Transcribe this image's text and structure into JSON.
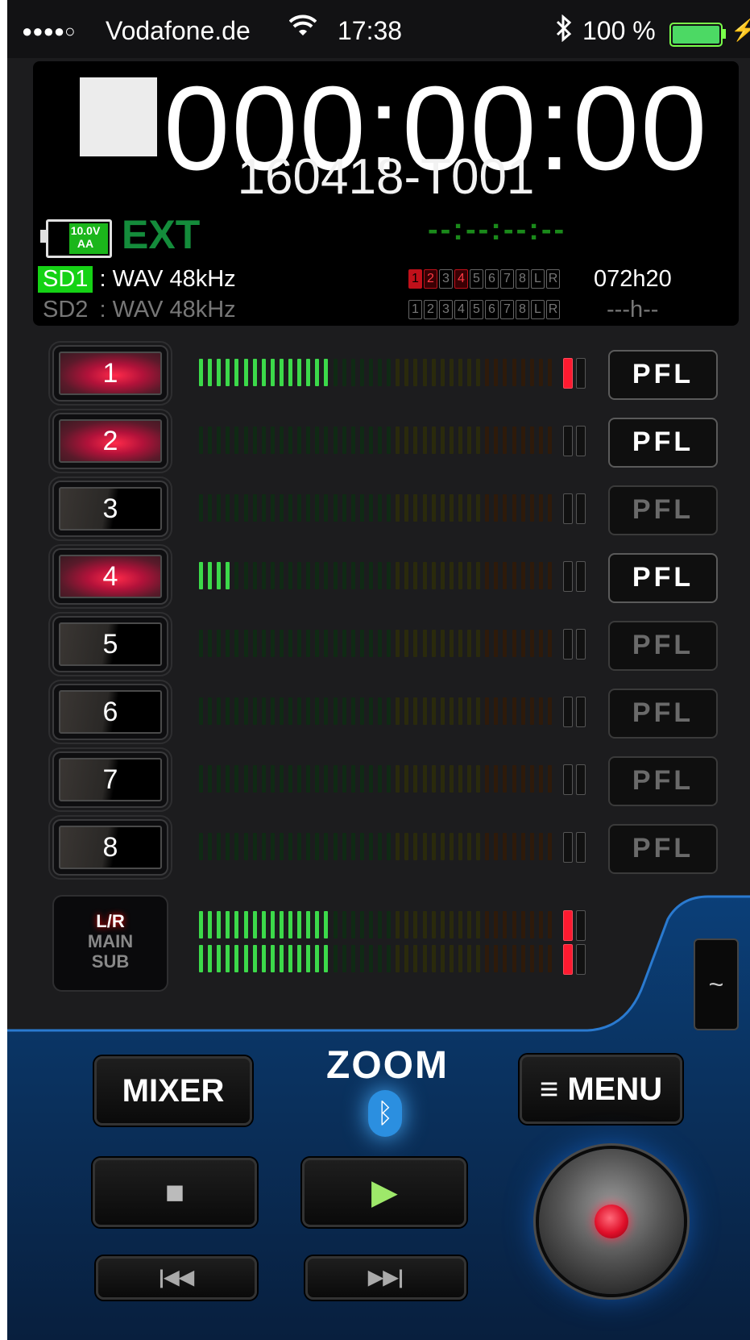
{
  "status_bar": {
    "signal": "●●●●○",
    "carrier": "Vodafone.de",
    "wifi_icon": "wifi-icon",
    "time": "17:38",
    "bluetooth_icon": "bluetooth-icon",
    "battery_percent": "100 %",
    "charging_icon": "⚡"
  },
  "display": {
    "timecode": "000:00:00",
    "take_name": "160418-T001",
    "battery": {
      "voltage": "10.0V",
      "type": "AA",
      "level": 1.0
    },
    "power_source": "EXT",
    "timecode_dashes": "--:--:--:--",
    "sd1": {
      "name": "SD1",
      "format": ": WAV 48kHz",
      "remaining": "072h20",
      "active": true
    },
    "sd2": {
      "name": "SD2",
      "format": ": WAV 48kHz",
      "remaining": "---h--",
      "active": false
    },
    "channels": [
      "1",
      "2",
      "3",
      "4",
      "5",
      "6",
      "7",
      "8",
      "L",
      "R"
    ],
    "sd1_armed_channels": [
      "1",
      "2",
      "4"
    ],
    "sd1_lit_channels": [
      "1",
      "3"
    ],
    "sd2_armed_channels": []
  },
  "tracks": [
    {
      "label": "1",
      "armed": true,
      "level": 0.37,
      "clip": true,
      "pfl": "PFL",
      "pfl_active": true
    },
    {
      "label": "2",
      "armed": true,
      "level": 0.0,
      "clip": false,
      "pfl": "PFL",
      "pfl_active": true
    },
    {
      "label": "3",
      "armed": false,
      "level": 0.0,
      "clip": false,
      "pfl": "PFL",
      "pfl_active": false
    },
    {
      "label": "4",
      "armed": true,
      "level": 0.1,
      "clip": false,
      "pfl": "PFL",
      "pfl_active": true
    },
    {
      "label": "5",
      "armed": false,
      "level": 0.0,
      "clip": false,
      "pfl": "PFL",
      "pfl_active": false
    },
    {
      "label": "6",
      "armed": false,
      "level": 0.0,
      "clip": false,
      "pfl": "PFL",
      "pfl_active": false
    },
    {
      "label": "7",
      "armed": false,
      "level": 0.0,
      "clip": false,
      "pfl": "PFL",
      "pfl_active": false
    },
    {
      "label": "8",
      "armed": false,
      "level": 0.0,
      "clip": false,
      "pfl": "PFL",
      "pfl_active": false
    }
  ],
  "main_out": {
    "labels": [
      "L/R",
      "MAIN",
      "SUB"
    ],
    "left_level": 0.37,
    "right_level": 0.37,
    "left_clip": true,
    "right_clip": true
  },
  "controls": {
    "mixer_label": "MIXER",
    "menu_label": "≡ MENU",
    "logo": "ZOOM",
    "bt_glyph": "ᛒ",
    "stop_glyph": "■",
    "play_glyph": "▶",
    "rewind_glyph": "|◀◀",
    "ffwd_glyph": "▶▶|",
    "wave_glyph": "~"
  }
}
